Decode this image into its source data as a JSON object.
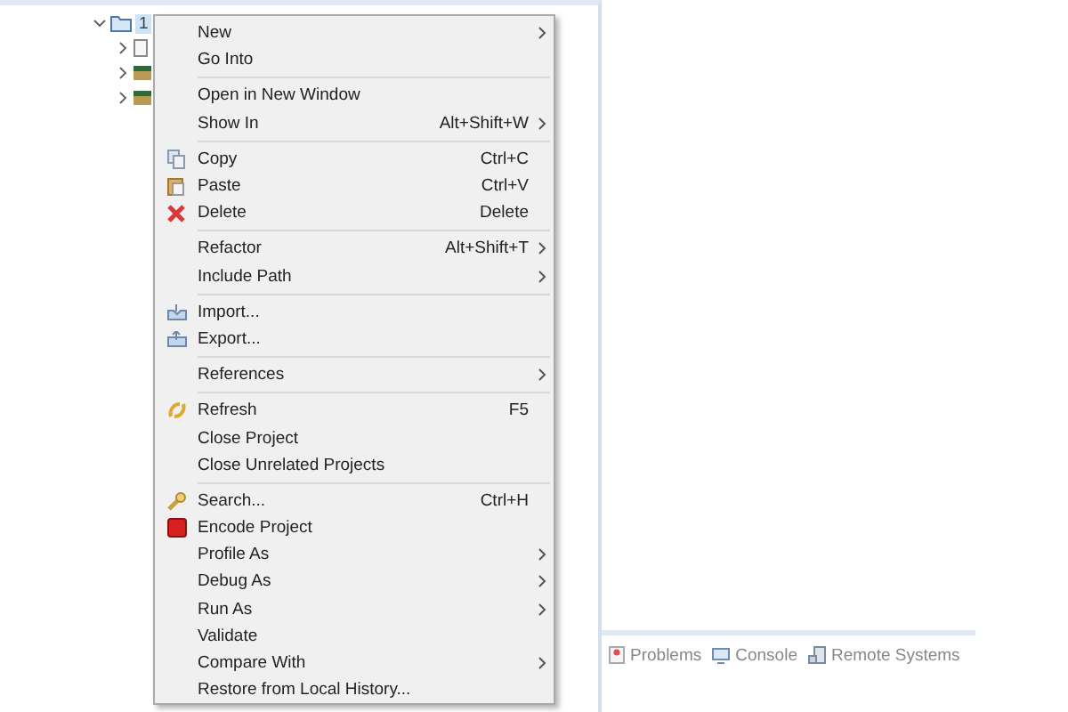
{
  "tree": {
    "project": {
      "label": "1",
      "expanded": true,
      "selected": true
    },
    "children": [
      {
        "kind": "file",
        "expanded": false
      },
      {
        "kind": "library",
        "expanded": false
      },
      {
        "kind": "library",
        "expanded": false
      }
    ]
  },
  "context_menu": {
    "groups": [
      [
        {
          "label": "New",
          "submenu": true
        },
        {
          "label": "Go Into",
          "submenu": false
        }
      ],
      [
        {
          "label": "Open in New Window",
          "submenu": false
        },
        {
          "label": "Show In",
          "shortcut": "Alt+Shift+W",
          "submenu": true
        }
      ],
      [
        {
          "label": "Copy",
          "shortcut": "Ctrl+C",
          "kind": "copy",
          "submenu": false
        },
        {
          "label": "Paste",
          "shortcut": "Ctrl+V",
          "kind": "paste",
          "submenu": false
        },
        {
          "label": "Delete",
          "shortcut": "Delete",
          "kind": "delete",
          "submenu": false
        }
      ],
      [
        {
          "label": "Refactor",
          "shortcut": "Alt+Shift+T",
          "submenu": true
        },
        {
          "label": "Include Path",
          "submenu": true
        }
      ],
      [
        {
          "label": "Import...",
          "kind": "import",
          "submenu": false
        },
        {
          "label": "Export...",
          "kind": "export",
          "submenu": false
        }
      ],
      [
        {
          "label": "References",
          "submenu": true
        }
      ],
      [
        {
          "label": "Refresh",
          "shortcut": "F5",
          "kind": "refresh",
          "submenu": false
        },
        {
          "label": "Close Project",
          "submenu": false
        },
        {
          "label": "Close Unrelated Projects",
          "submenu": false
        }
      ],
      [
        {
          "label": "Search...",
          "shortcut": "Ctrl+H",
          "kind": "search",
          "submenu": false
        },
        {
          "label": "Encode Project",
          "kind": "encode",
          "submenu": false
        },
        {
          "label": "Profile As",
          "submenu": true
        },
        {
          "label": "Debug As",
          "submenu": true
        },
        {
          "label": "Run As",
          "submenu": true
        },
        {
          "label": "Validate",
          "submenu": false
        },
        {
          "label": "Compare With",
          "submenu": true
        },
        {
          "label": "Restore from Local History...",
          "submenu": false
        }
      ]
    ]
  },
  "bottom_tabs": [
    {
      "label": "Problems",
      "kind": "problems"
    },
    {
      "label": "Console",
      "kind": "console"
    },
    {
      "label": "Remote Systems",
      "kind": "remote"
    }
  ]
}
